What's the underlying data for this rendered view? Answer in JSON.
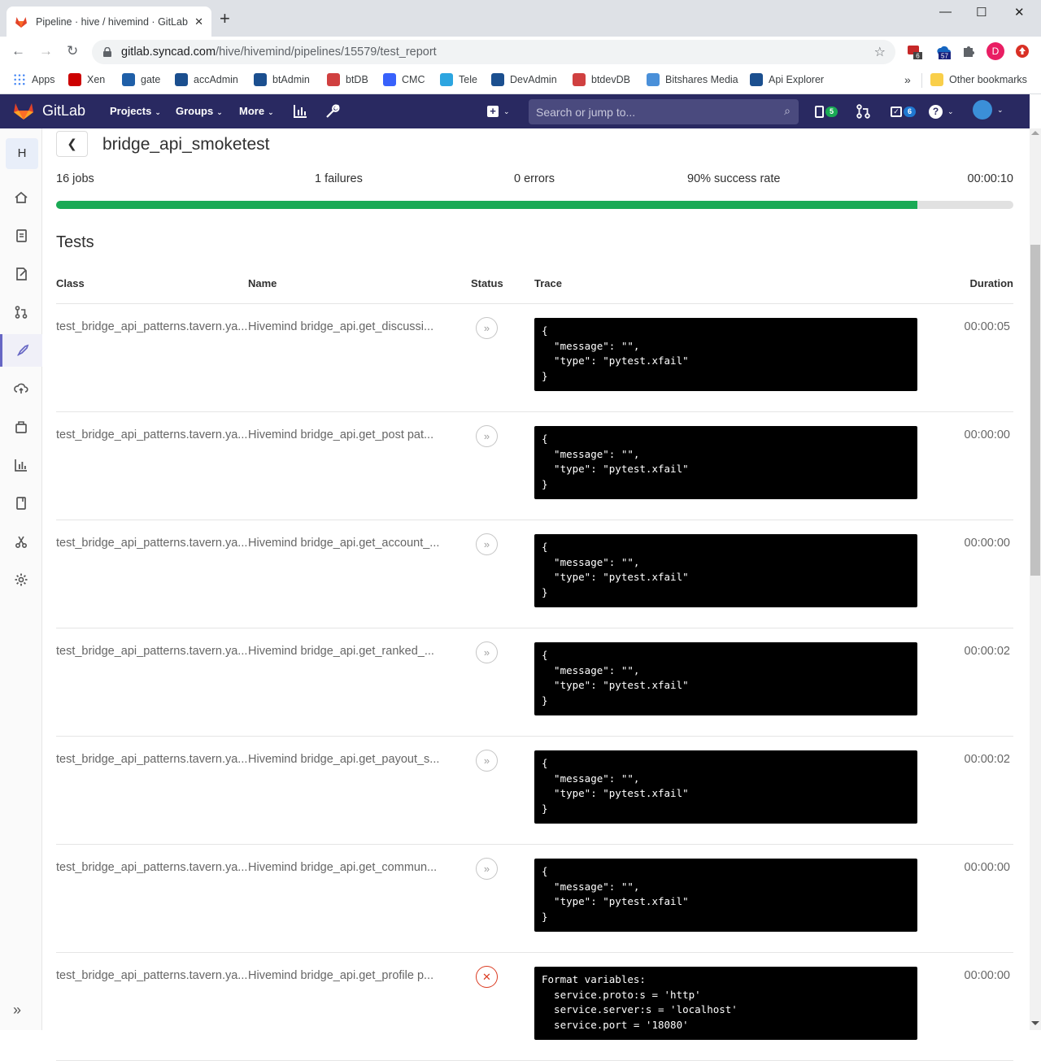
{
  "browser": {
    "tab_title": "Pipeline · hive / hivemind · GitLab",
    "url_host": "gitlab.syncad.com",
    "url_path": "/hive/hivemind/pipelines/15579/test_report",
    "ext_badges": [
      "6",
      "57"
    ],
    "profile_letter": "D",
    "bookmarks": [
      {
        "label": "Apps",
        "icon": "apps-grid-icon",
        "color": "#4285f4"
      },
      {
        "label": "Xen",
        "icon": "xen-icon",
        "color": "#cc0000"
      },
      {
        "label": "gate",
        "icon": "gate-icon",
        "color": "#1f5fa8"
      },
      {
        "label": "accAdmin",
        "icon": "bitshares-icon",
        "color": "#1b4f8f"
      },
      {
        "label": "btAdmin",
        "icon": "bitshares-icon",
        "color": "#1b4f8f"
      },
      {
        "label": "btDB",
        "icon": "db-icon",
        "color": "#d04040"
      },
      {
        "label": "CMC",
        "icon": "cmc-icon",
        "color": "#3861fb"
      },
      {
        "label": "Tele",
        "icon": "telegram-icon",
        "color": "#2ca5e0"
      },
      {
        "label": "DevAdmin",
        "icon": "bitshares-icon",
        "color": "#1b4f8f"
      },
      {
        "label": "btdevDB",
        "icon": "db-icon",
        "color": "#d04040"
      },
      {
        "label": "Bitshares Media",
        "icon": "bitshares-media-icon",
        "color": "#4a90d9"
      },
      {
        "label": "Api Explorer",
        "icon": "bitshares-icon",
        "color": "#1b4f8f"
      }
    ],
    "overflow_label": "»",
    "other_bookmarks": "Other bookmarks"
  },
  "gitlab": {
    "brand": "GitLab",
    "nav": {
      "projects": "Projects",
      "groups": "Groups",
      "more": "More"
    },
    "search_placeholder": "Search or jump to...",
    "issues_count": "5",
    "todos_count": "6"
  },
  "sidebar": {
    "project_letter": "H",
    "items": [
      "project-overview",
      "repository",
      "issues",
      "merge-requests",
      "ci-cd",
      "operations",
      "packages",
      "analytics",
      "wiki",
      "snippets",
      "settings"
    ],
    "active": "ci-cd",
    "collapse_label": "»"
  },
  "report": {
    "suite_name": "bridge_api_smoketest",
    "jobs": "16 jobs",
    "failures": "1 failures",
    "errors": "0 errors",
    "success_rate_label": "90% success rate",
    "success_rate": 0.9,
    "total_duration": "00:00:10",
    "section_title": "Tests",
    "columns": {
      "class": "Class",
      "name": "Name",
      "status": "Status",
      "trace": "Trace",
      "duration": "Duration"
    },
    "rows": [
      {
        "class": "test_bridge_api_patterns.tavern.ya...",
        "name": "Hivemind bridge_api.get_discussi...",
        "status": "skipped",
        "trace": "{\n  \"message\": \"\",\n  \"type\": \"pytest.xfail\"\n}",
        "duration": "00:00:05"
      },
      {
        "class": "test_bridge_api_patterns.tavern.ya...",
        "name": "Hivemind bridge_api.get_post pat...",
        "status": "skipped",
        "trace": "{\n  \"message\": \"\",\n  \"type\": \"pytest.xfail\"\n}",
        "duration": "00:00:00"
      },
      {
        "class": "test_bridge_api_patterns.tavern.ya...",
        "name": "Hivemind bridge_api.get_account_...",
        "status": "skipped",
        "trace": "{\n  \"message\": \"\",\n  \"type\": \"pytest.xfail\"\n}",
        "duration": "00:00:00"
      },
      {
        "class": "test_bridge_api_patterns.tavern.ya...",
        "name": "Hivemind bridge_api.get_ranked_...",
        "status": "skipped",
        "trace": "{\n  \"message\": \"\",\n  \"type\": \"pytest.xfail\"\n}",
        "duration": "00:00:02"
      },
      {
        "class": "test_bridge_api_patterns.tavern.ya...",
        "name": "Hivemind bridge_api.get_payout_s...",
        "status": "skipped",
        "trace": "{\n  \"message\": \"\",\n  \"type\": \"pytest.xfail\"\n}",
        "duration": "00:00:02"
      },
      {
        "class": "test_bridge_api_patterns.tavern.ya...",
        "name": "Hivemind bridge_api.get_commun...",
        "status": "skipped",
        "trace": "{\n  \"message\": \"\",\n  \"type\": \"pytest.xfail\"\n}",
        "duration": "00:00:00"
      },
      {
        "class": "test_bridge_api_patterns.tavern.ya...",
        "name": "Hivemind bridge_api.get_profile p...",
        "status": "failed",
        "trace": "Format variables:\n  service.proto:s = 'http'\n  service.server:s = 'localhost'\n  service.port = '18080'",
        "duration": "00:00:00"
      }
    ]
  },
  "colors": {
    "header_bg": "#292961",
    "success": "#1aaa55",
    "failed": "#db3b21",
    "trace_bg": "#000000"
  }
}
